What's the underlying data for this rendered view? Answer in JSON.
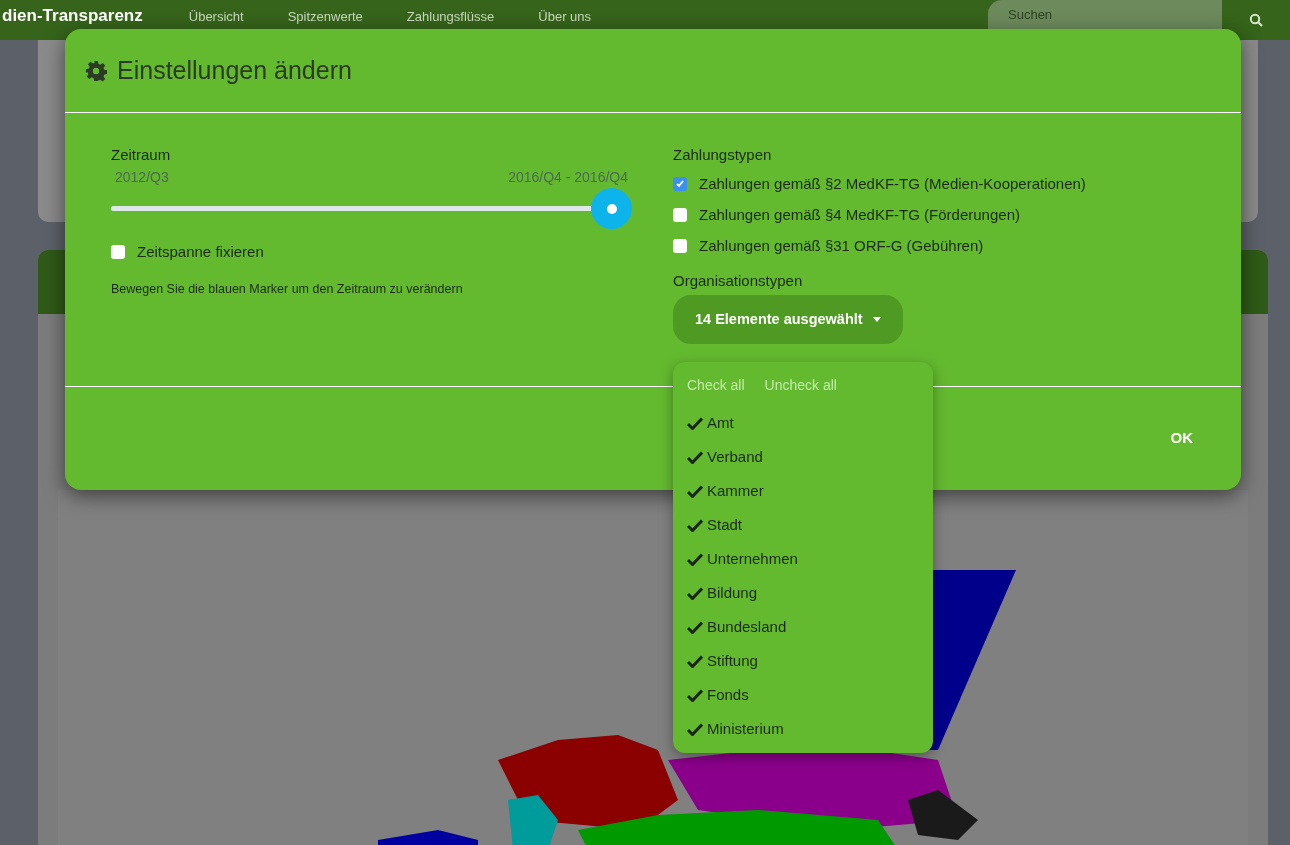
{
  "navbar": {
    "brand": "dien-Transparenz",
    "links": [
      "Übersicht",
      "Spitzenwerte",
      "Zahlungsflüsse",
      "Über uns"
    ],
    "search": {
      "placeholder": "Suchen"
    }
  },
  "dialog": {
    "title": "Einstellungen ändern",
    "period": {
      "label": "Zeitraum",
      "start": "2012/Q3",
      "range": "2016/Q4 - 2016/Q4",
      "level": 1,
      "fix": {
        "label": "Zeitspanne fixieren",
        "checked": false
      },
      "hint": "Bewegen Sie die blauen Marker um den Zeitraum zu verändern"
    },
    "payment_types": {
      "label": "Zahlungstypen",
      "options": [
        {
          "label": "Zahlungen gemäß §2 MedKF-TG (Medien-Kooperationen)",
          "checked": true
        },
        {
          "label": "Zahlungen gemäß §4 MedKF-TG (Förderungen)",
          "checked": false
        },
        {
          "label": "Zahlungen gemäß §31 ORF-G (Gebühren)",
          "checked": false
        }
      ]
    },
    "organisation_types": {
      "label": "Organisationstypen",
      "button": "14 Elemente ausgewählt",
      "menu": {
        "check_all": "Check all",
        "uncheck_all": "Uncheck all",
        "items": [
          {
            "label": "Amt",
            "checked": true
          },
          {
            "label": "Verband",
            "checked": true
          },
          {
            "label": "Kammer",
            "checked": true
          },
          {
            "label": "Stadt",
            "checked": true
          },
          {
            "label": "Unternehmen",
            "checked": true
          },
          {
            "label": "Bildung",
            "checked": true
          },
          {
            "label": "Bundesland",
            "checked": true
          },
          {
            "label": "Stiftung",
            "checked": true
          },
          {
            "label": "Fonds",
            "checked": true
          },
          {
            "label": "Ministerium",
            "checked": true
          }
        ]
      }
    },
    "ok": "OK"
  }
}
